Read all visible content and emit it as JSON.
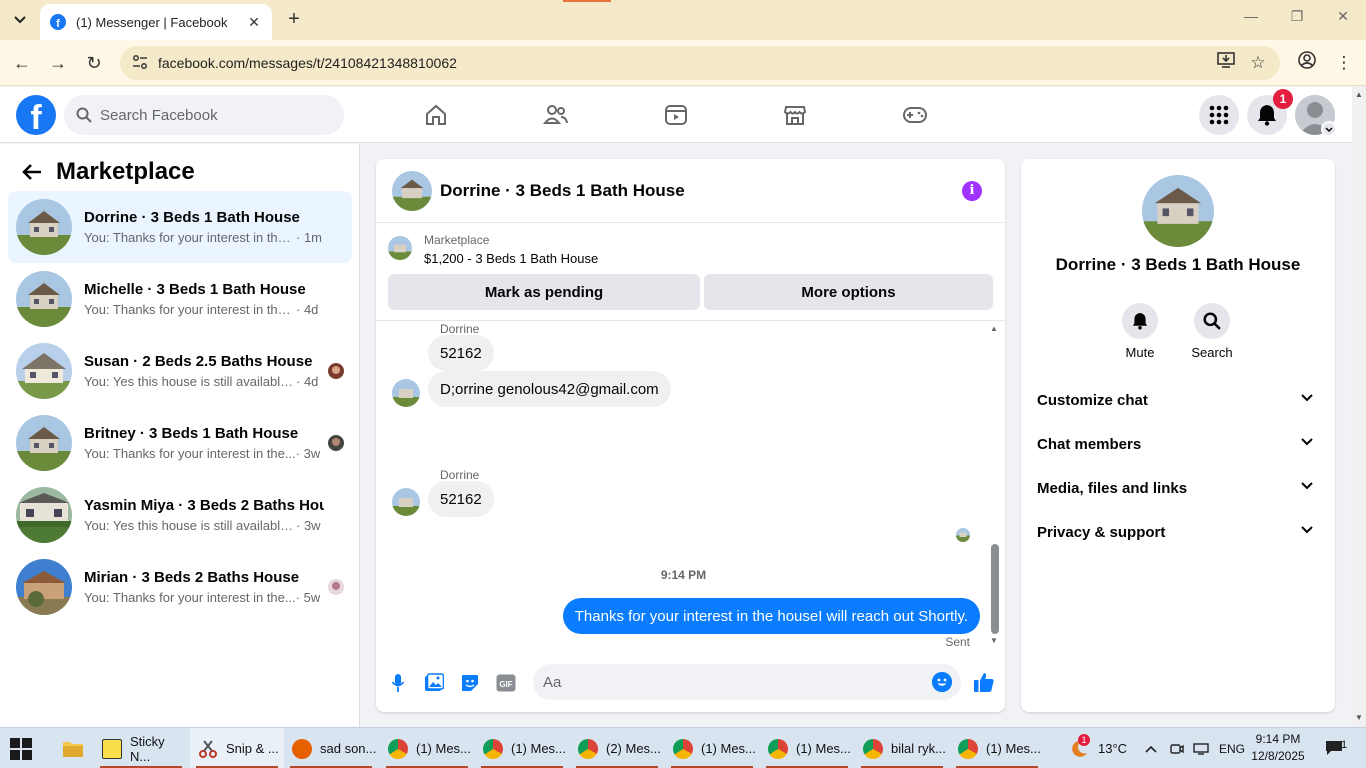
{
  "browser": {
    "tab_title": "(1) Messenger | Facebook",
    "url": "facebook.com/messages/t/24108421348810062"
  },
  "fb": {
    "search_placeholder": "Search Facebook",
    "notification_count": "1"
  },
  "left": {
    "title": "Marketplace",
    "conversations": [
      {
        "name": "Dorrine · 3 Beds 1 Bath House",
        "snippet": "You: Thanks for your interest in the h...",
        "time": "· 1m",
        "active": true
      },
      {
        "name": "Michelle · 3 Beds 1 Bath House",
        "snippet": "You: Thanks for your interest in the ho...",
        "time": "· 4d"
      },
      {
        "name": "Susan · 2 Beds 2.5 Baths House",
        "snippet": "You: Yes this house is still available ...",
        "time": "· 4d"
      },
      {
        "name": "Britney · 3 Beds 1 Bath House",
        "snippet": "You: Thanks for your interest in the...",
        "time": "· 3w"
      },
      {
        "name": "Yasmin Miya · 3 Beds 2 Baths House",
        "snippet": "You: Yes this house is still available for...",
        "time": "· 3w"
      },
      {
        "name": "Mirian · 3 Beds 2 Baths House",
        "snippet": "You: Thanks for your interest in the...",
        "time": "· 5w"
      }
    ]
  },
  "chat": {
    "title": "Dorrine · 3 Beds 1 Bath House",
    "marketplace_label": "Marketplace",
    "listing": "$1,200 - 3 Beds 1 Bath House",
    "mark_pending": "Mark as pending",
    "more_options": "More options",
    "messages": {
      "sender1": "Dorrine",
      "msg1": "52162",
      "msg2": "D;orrine genolous42@gmail.com",
      "sender2": "Dorrine",
      "msg3": "52162",
      "time": "9:14 PM",
      "outgoing": "Thanks for your interest in the houseI will reach out Shortly.",
      "status": "Sent"
    },
    "composer_placeholder": "Aa"
  },
  "right": {
    "name": "Dorrine · 3 Beds 1 Bath House",
    "mute": "Mute",
    "search": "Search",
    "rows": [
      "Customize chat",
      "Chat members",
      "Media, files and links",
      "Privacy & support"
    ]
  },
  "taskbar": {
    "items": [
      "Sticky N...",
      "Snip & ...",
      "sad son...",
      "(1) Mes...",
      "(1) Mes...",
      "(2) Mes...",
      "(1) Mes...",
      "(1) Mes...",
      "bilal ryk...",
      "(1) Mes..."
    ],
    "weather": "13°C",
    "lang": "ENG",
    "time": "9:14 PM",
    "date": "12/8/2025",
    "notif_count": "1",
    "weather_badge": "1"
  }
}
